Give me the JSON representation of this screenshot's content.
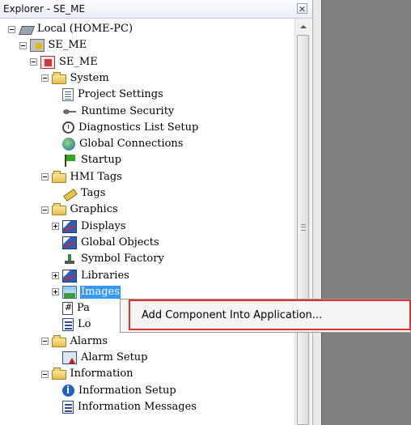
{
  "window": {
    "title": "Explorer - SE_ME"
  },
  "tree": [
    {
      "label": "Local (HOME-PC)",
      "icon": "computer-icon",
      "expander": "minus",
      "level": 0
    },
    {
      "label": "SE_ME",
      "icon": "application-icon",
      "expander": "minus",
      "level": 1
    },
    {
      "label": "SE_ME",
      "icon": "hmi-server-icon",
      "expander": "minus",
      "level": 2
    },
    {
      "label": "System",
      "icon": "folder-icon",
      "expander": "minus",
      "level": 3
    },
    {
      "label": "Project Settings",
      "icon": "document-icon",
      "level": 4
    },
    {
      "label": "Runtime Security",
      "icon": "key-icon",
      "level": 4
    },
    {
      "label": "Diagnostics List Setup",
      "icon": "clock-icon",
      "level": 4
    },
    {
      "label": "Global Connections",
      "icon": "globe-icon",
      "level": 4
    },
    {
      "label": "Startup",
      "icon": "flag-icon",
      "level": 4
    },
    {
      "label": "HMI Tags",
      "icon": "folder-icon",
      "expander": "minus",
      "level": 3
    },
    {
      "label": "Tags",
      "icon": "tag-icon",
      "level": 4
    },
    {
      "label": "Graphics",
      "icon": "folder-icon",
      "expander": "minus",
      "level": 3
    },
    {
      "label": "Displays",
      "icon": "display-icon",
      "expander": "plus",
      "level": 4
    },
    {
      "label": "Global Objects",
      "icon": "display-icon",
      "level": 4
    },
    {
      "label": "Symbol Factory",
      "icon": "symbol-icon",
      "level": 4
    },
    {
      "label": "Libraries",
      "icon": "display-icon",
      "expander": "plus",
      "level": 4
    },
    {
      "label": "Images",
      "icon": "image-icon",
      "expander": "plus",
      "level": 4,
      "selected": true
    },
    {
      "label": "Pa",
      "icon": "parameter-icon",
      "level": 4
    },
    {
      "label": "Lo",
      "icon": "messages-icon",
      "level": 4
    },
    {
      "label": "Alarms",
      "icon": "folder-icon",
      "expander": "minus",
      "level": 3
    },
    {
      "label": "Alarm Setup",
      "icon": "alarm-icon",
      "level": 4
    },
    {
      "label": "Information",
      "icon": "folder-icon",
      "expander": "minus",
      "level": 3
    },
    {
      "label": "Information Setup",
      "icon": "info-icon",
      "level": 4
    },
    {
      "label": "Information Messages",
      "icon": "messages-icon",
      "level": 4
    }
  ],
  "context_menu": {
    "items": [
      {
        "label": "Add Component Into Application..."
      }
    ],
    "highlight_color": "#e03030"
  },
  "colors": {
    "selection": "#3399ff",
    "workspace": "#808080"
  }
}
